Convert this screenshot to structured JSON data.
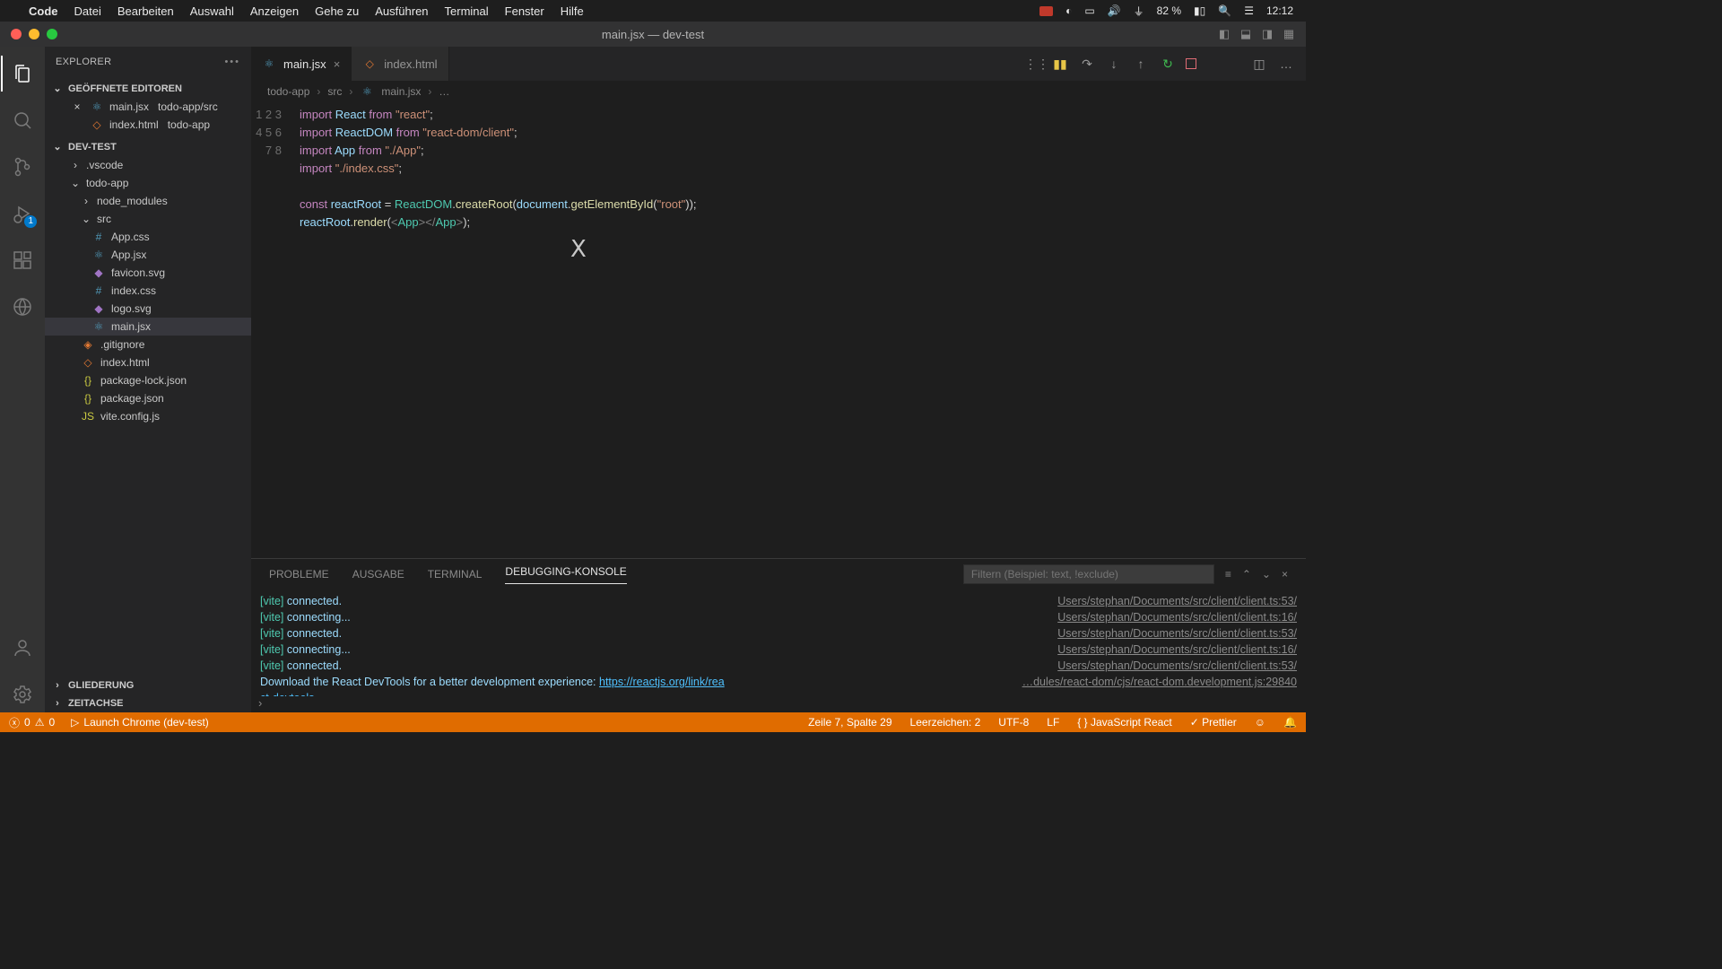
{
  "menubar": {
    "app": "Code",
    "items": [
      "Datei",
      "Bearbeiten",
      "Auswahl",
      "Anzeigen",
      "Gehe zu",
      "Ausführen",
      "Terminal",
      "Fenster",
      "Hilfe"
    ],
    "battery": "82 %",
    "clock": "12:12"
  },
  "window_title": "main.jsx — dev-test",
  "sidebar": {
    "title": "EXPLORER",
    "open_editors_label": "GEÖFFNETE EDITOREN",
    "open_editors": [
      {
        "name": "main.jsx",
        "detail": "todo-app/src",
        "modified": true
      },
      {
        "name": "index.html",
        "detail": "todo-app",
        "modified": false
      }
    ],
    "workspace": "DEV-TEST",
    "tree": {
      "vscode": ".vscode",
      "todo_app": "todo-app",
      "node_modules": "node_modules",
      "src": "src",
      "files": [
        "App.css",
        "App.jsx",
        "favicon.svg",
        "index.css",
        "logo.svg",
        "main.jsx"
      ],
      "root_files": [
        ".gitignore",
        "index.html",
        "package-lock.json",
        "package.json",
        "vite.config.js"
      ]
    },
    "outline": "GLIEDERUNG",
    "timeline": "ZEITACHSE"
  },
  "tabs": [
    {
      "icon": "react",
      "label": "main.jsx",
      "active": true,
      "close": true
    },
    {
      "icon": "html",
      "label": "index.html",
      "active": false,
      "close": false
    }
  ],
  "breadcrumb": [
    "todo-app",
    "src",
    "main.jsx",
    "…"
  ],
  "code": {
    "lines": 8,
    "l1": {
      "a": "import",
      "b": "React",
      "c": "from",
      "d": "\"react\"",
      "e": ";"
    },
    "l2": {
      "a": "import",
      "b": "ReactDOM",
      "c": "from",
      "d": "\"react-dom/client\"",
      "e": ";"
    },
    "l3": {
      "a": "import",
      "b": "App",
      "c": "from",
      "d": "\"./App\"",
      "e": ";"
    },
    "l4": {
      "a": "import",
      "d": "\"./index.css\"",
      "e": ";"
    },
    "l6": {
      "a": "const",
      "b": "reactRoot",
      "eq": "=",
      "c": "ReactDOM",
      "dot": ".",
      "fn": "createRoot",
      "op": "(",
      "d": "document",
      "dot2": ".",
      "fn2": "getElementById",
      "op2": "(",
      "s": "\"root\"",
      "cp": "));"
    },
    "l7": {
      "b": "reactRoot",
      "dot": ".",
      "fn": "render",
      "op": "(",
      "t1": "<",
      "tag": "App",
      "t2": "></",
      "tag2": "App",
      "t3": ">",
      "cp": ");"
    }
  },
  "panel": {
    "tabs": [
      "PROBLEME",
      "AUSGABE",
      "TERMINAL",
      "DEBUGGING-KONSOLE"
    ],
    "active_tab": "DEBUGGING-KONSOLE",
    "filter_placeholder": "Filtern (Beispiel: text, !exclude)",
    "rows": [
      {
        "msg": [
          "[vite]",
          " connected."
        ],
        "src": "Users/stephan/Documents/src/client/client.ts:53/"
      },
      {
        "msg": [
          "[vite]",
          " connecting..."
        ],
        "src": "Users/stephan/Documents/src/client/client.ts:16/"
      },
      {
        "msg": [
          "[vite]",
          " connected."
        ],
        "src": "Users/stephan/Documents/src/client/client.ts:53/"
      },
      {
        "msg": [
          "[vite]",
          " connecting..."
        ],
        "src": "Users/stephan/Documents/src/client/client.ts:16/"
      },
      {
        "msg": [
          "[vite]",
          " connected."
        ],
        "src": "Users/stephan/Documents/src/client/client.ts:53/"
      }
    ],
    "devtools_a": "Download the React DevTools for a better development experience: ",
    "devtools_b": "https://reactjs.org/link/rea",
    "devtools_c": " …dules/react-dom/cjs/react-dom.development.js:29840",
    "devtools_d": "ct-devtools"
  },
  "statusbar": {
    "errors": "0",
    "warnings": "0",
    "launch": "Launch Chrome (dev-test)",
    "cursor": "Zeile 7, Spalte 29",
    "indent": "Leerzeichen: 2",
    "encoding": "UTF-8",
    "eol": "LF",
    "lang": "JavaScript React",
    "prettier": "Prettier"
  },
  "activity_badge": "1"
}
